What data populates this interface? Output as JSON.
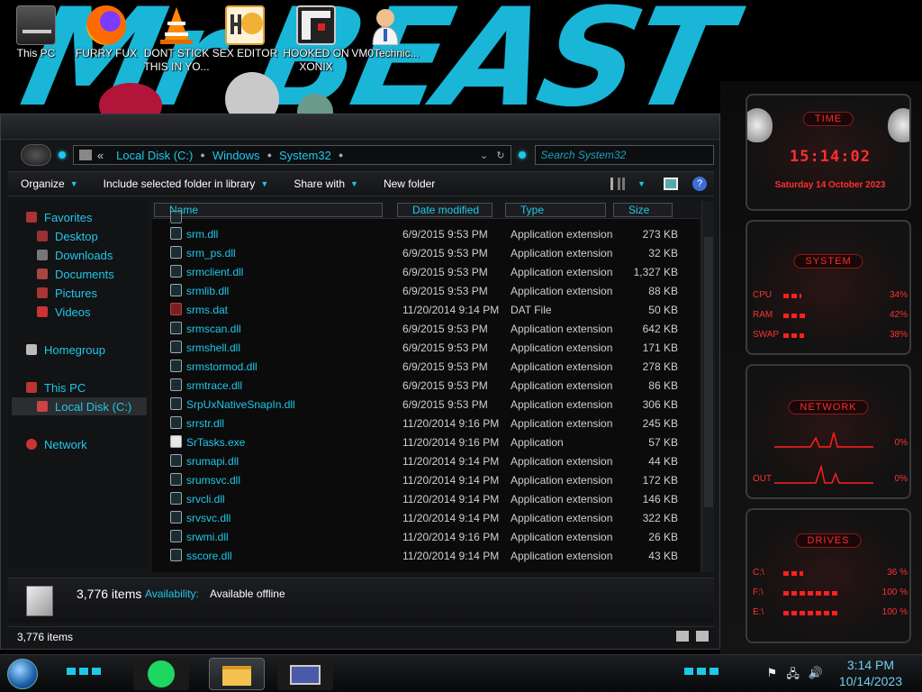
{
  "desktop": {
    "wallpaper_word": "Mr BEAST",
    "icons": [
      {
        "label": "This PC"
      },
      {
        "label": "FURRY FUX"
      },
      {
        "label": "DONT STICK THIS IN YO..."
      },
      {
        "label": "SEX EDITOR"
      },
      {
        "label": "HOOKED ON XONIX"
      },
      {
        "label": "VM0Technic..."
      }
    ]
  },
  "address": {
    "prefix": "«",
    "segments": [
      "Local Disk (C:)",
      "Windows",
      "System32"
    ],
    "search_placeholder": "Search System32"
  },
  "toolbar": {
    "organize": "Organize",
    "include": "Include selected folder in library",
    "share": "Share with",
    "new_folder": "New folder"
  },
  "navpane": {
    "favorites": "Favorites",
    "desktop": "Desktop",
    "downloads": "Downloads",
    "documents": "Documents",
    "pictures": "Pictures",
    "videos": "Videos",
    "homegroup": "Homegroup",
    "this_pc": "This PC",
    "local_disk": "Local Disk (C:)",
    "network": "Network"
  },
  "columns": {
    "name": "Name",
    "date": "Date modified",
    "type": "Type",
    "size": "Size"
  },
  "files": [
    {
      "name": "srm.dll",
      "date": "6/9/2015 9:53 PM",
      "type": "Application extension",
      "size": "273 KB"
    },
    {
      "name": "srm_ps.dll",
      "date": "6/9/2015 9:53 PM",
      "type": "Application extension",
      "size": "32 KB"
    },
    {
      "name": "srmclient.dll",
      "date": "6/9/2015 9:53 PM",
      "type": "Application extension",
      "size": "1,327 KB"
    },
    {
      "name": "srmlib.dll",
      "date": "6/9/2015 9:53 PM",
      "type": "Application extension",
      "size": "88 KB"
    },
    {
      "name": "srms.dat",
      "date": "11/20/2014 9:14 PM",
      "type": "DAT File",
      "size": "50 KB"
    },
    {
      "name": "srmscan.dll",
      "date": "6/9/2015 9:53 PM",
      "type": "Application extension",
      "size": "642 KB"
    },
    {
      "name": "srmshell.dll",
      "date": "6/9/2015 9:53 PM",
      "type": "Application extension",
      "size": "171 KB"
    },
    {
      "name": "srmstormod.dll",
      "date": "6/9/2015 9:53 PM",
      "type": "Application extension",
      "size": "278 KB"
    },
    {
      "name": "srmtrace.dll",
      "date": "6/9/2015 9:53 PM",
      "type": "Application extension",
      "size": "86 KB"
    },
    {
      "name": "SrpUxNativeSnapIn.dll",
      "date": "6/9/2015 9:53 PM",
      "type": "Application extension",
      "size": "306 KB"
    },
    {
      "name": "srrstr.dll",
      "date": "11/20/2014 9:16 PM",
      "type": "Application extension",
      "size": "245 KB"
    },
    {
      "name": "SrTasks.exe",
      "date": "11/20/2014 9:16 PM",
      "type": "Application",
      "size": "57 KB"
    },
    {
      "name": "srumapi.dll",
      "date": "11/20/2014 9:14 PM",
      "type": "Application extension",
      "size": "44 KB"
    },
    {
      "name": "srumsvc.dll",
      "date": "11/20/2014 9:14 PM",
      "type": "Application extension",
      "size": "172 KB"
    },
    {
      "name": "srvcli.dll",
      "date": "11/20/2014 9:14 PM",
      "type": "Application extension",
      "size": "146 KB"
    },
    {
      "name": "srvsvc.dll",
      "date": "11/20/2014 9:14 PM",
      "type": "Application extension",
      "size": "322 KB"
    },
    {
      "name": "srwmi.dll",
      "date": "11/20/2014 9:16 PM",
      "type": "Application extension",
      "size": "26 KB"
    },
    {
      "name": "sscore.dll",
      "date": "11/20/2014 9:14 PM",
      "type": "Application extension",
      "size": "43 KB"
    }
  ],
  "details": {
    "count": "3,776 items",
    "availability_label": "Availability:",
    "availability_value": "Available offline"
  },
  "status": {
    "count": "3,776 items"
  },
  "gadgets": {
    "time_title": "TIME",
    "time": "15:14:02",
    "date": "Saturday 14 October 2023",
    "system_title": "SYSTEM",
    "cpu_label": "CPU",
    "cpu_value": "34%",
    "cpu_level": 0.34,
    "ram_label": "RAM",
    "ram_value": "42%",
    "ram_level": 0.42,
    "swap_label": "SWAP",
    "swap_value": "38%",
    "swap_level": 0.38,
    "network_title": "NETWORK",
    "net_in_value": "0%",
    "net_out_label": "OUT",
    "net_out_value": "0%",
    "drives_title": "DRIVES",
    "drive_c": "C:\\",
    "drive_c_value": "36 %",
    "drive_c_level": 0.36,
    "drive_f": "F:\\",
    "drive_f_value": "100 %",
    "drive_f_level": 1.0,
    "drive_e": "E:\\",
    "drive_e_value": "100 %",
    "drive_e_level": 1.0
  },
  "taskbar": {
    "time": "3:14 PM",
    "date": "10/14/2023"
  },
  "colors": {
    "accent": "#1ec8e8",
    "gadget_red": "#ff3030",
    "background": "#151618"
  }
}
